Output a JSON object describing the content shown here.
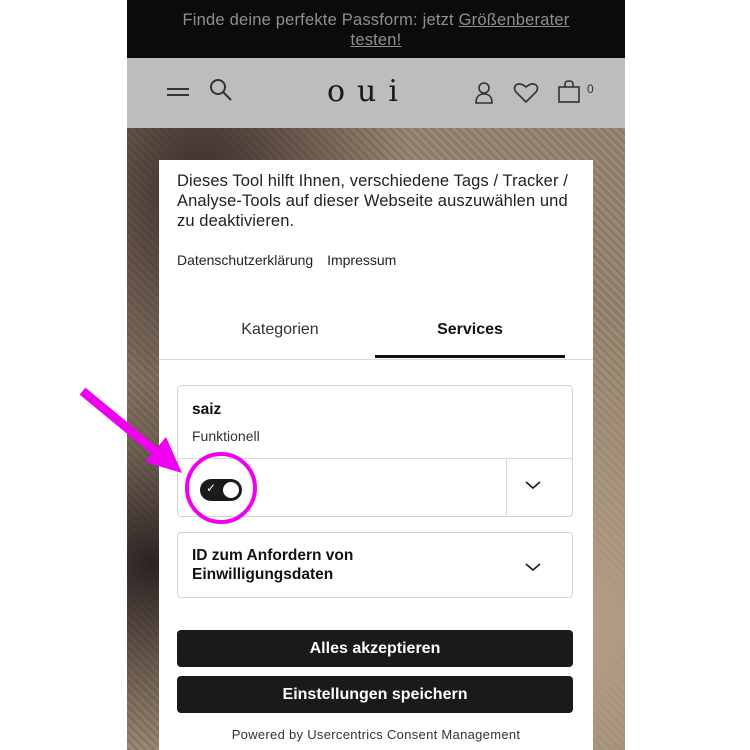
{
  "promo_banner": {
    "text": "Finde deine perfekte Passform: jetzt ",
    "link_text_1": "Größenberater",
    "link_text_2": "testen!"
  },
  "header": {
    "logo": "oui",
    "cart_count": "0",
    "icons": [
      "menu-icon",
      "search-icon",
      "account-icon",
      "wishlist-icon",
      "cart-icon"
    ]
  },
  "consent": {
    "description": "Dieses Tool hilft Ihnen, verschiedene Tags / Tracker / Analyse-Tools auf dieser Webseite auszuwählen und zu deaktivieren.",
    "links": {
      "privacy": "Datenschutzerklärung",
      "imprint": "Impressum"
    },
    "tabs": [
      {
        "label": "Kategorien",
        "active": false
      },
      {
        "label": "Services",
        "active": true
      }
    ],
    "services": [
      {
        "name": "saiz",
        "category": "Funktionell",
        "enabled": true
      }
    ],
    "id_section": {
      "title": "ID zum Anfordern von Einwilligungsdaten"
    },
    "buttons": {
      "accept_all": "Alles akzeptieren",
      "save_settings": "Einstellungen speichern"
    },
    "powered_by": "Powered by Usercentrics Consent Management"
  },
  "colors": {
    "annotation": "#f000f0",
    "button_bg": "#1a1a1a",
    "banner_bg": "#0b0b0b"
  }
}
